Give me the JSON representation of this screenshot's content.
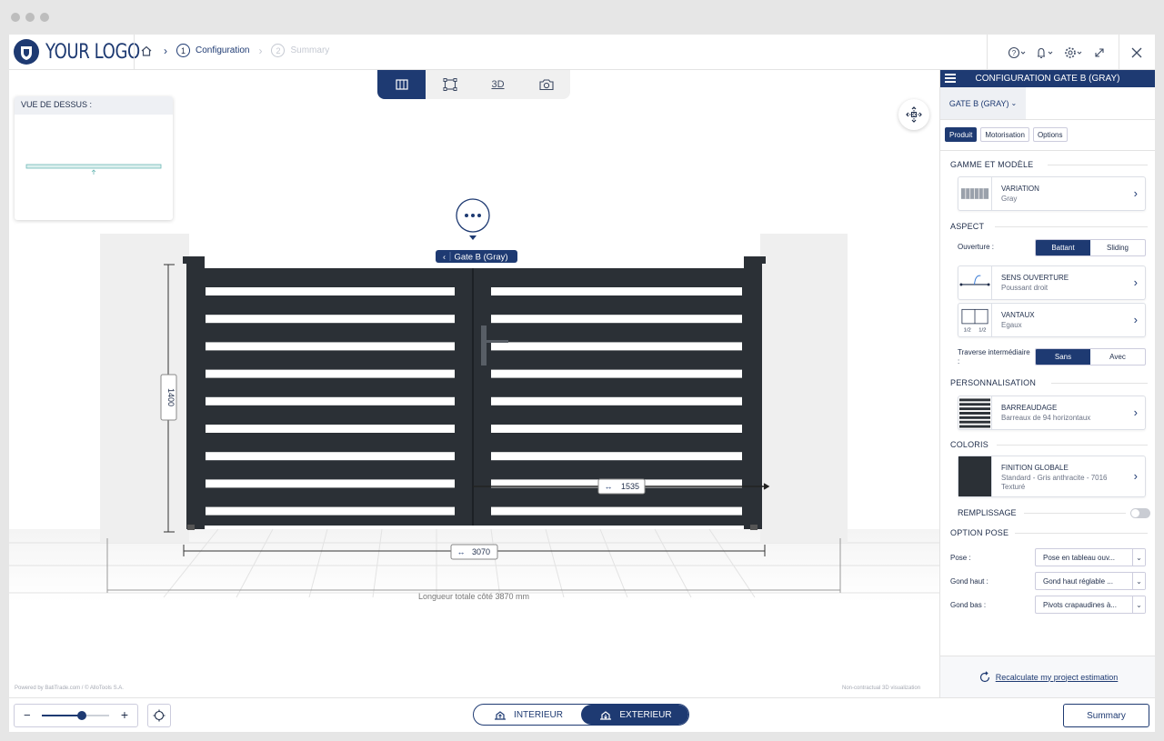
{
  "header": {
    "logo_text": "YOUR LOGO",
    "steps": [
      {
        "num": "1",
        "label": "Configuration",
        "active": true
      },
      {
        "num": "2",
        "label": "Summary",
        "active": false
      }
    ]
  },
  "viewer": {
    "view_tabs": [
      "plan-icon",
      "frame-icon",
      "3D",
      "camera-icon"
    ],
    "view_tab_3d_label": "3D",
    "top_view_title": "VUE DE DESSUS :",
    "gate_label": "Gate B (Gray)",
    "dim_height": "1400",
    "dim_leaf_width": "1535",
    "dim_gate_width": "3070",
    "total_length_label": "Longueur totale côté 3870 mm",
    "powered_by": "Powered by BatiTrade.com / © AlloTools S.A.",
    "non_contractual": "Non-contractual 3D visualization",
    "zoom_level": 0.6
  },
  "bottom": {
    "interior_label": "INTERIEUR",
    "exterior_label": "EXTERIEUR",
    "summary_label": "Summary"
  },
  "panel": {
    "title": "CONFIGURATION GATE B (GRAY)",
    "gate_select": "GATE B (GRAY)",
    "tabs": [
      "Produit",
      "Motorisation",
      "Options"
    ],
    "sections": {
      "gamme": "GAMME ET MODÈLE",
      "aspect": "ASPECT",
      "perso": "PERSONNALISATION",
      "coloris": "COLORIS",
      "option_pose": "OPTION POSE"
    },
    "variation": {
      "title": "VARIATION",
      "sub": "Gray"
    },
    "ouverture": {
      "label": "Ouverture :",
      "options": [
        "Battant",
        "Sliding"
      ],
      "selected": "Battant"
    },
    "sens": {
      "title": "SENS OUVERTURE",
      "sub": "Poussant droit"
    },
    "vantaux": {
      "title": "VANTAUX",
      "sub": "Egaux",
      "img_label_left": "1/2",
      "img_label_right": "1/2"
    },
    "traverse": {
      "label": "Traverse intermédiaire :",
      "options": [
        "Sans",
        "Avec"
      ],
      "selected": "Sans"
    },
    "barreaudage": {
      "title": "BARREAUDAGE",
      "sub": "Barreaux de 94 horizontaux"
    },
    "finition": {
      "title": "FINITION GLOBALE",
      "sub": "Standard - Gris anthracite - 7016 Texturé"
    },
    "remplissage": {
      "label": "REMPLISSAGE",
      "enabled": false
    },
    "pose": {
      "label": "Pose :",
      "value": "Pose en tableau ouv..."
    },
    "gond_haut": {
      "label": "Gond haut :",
      "value": "Gond haut réglable ..."
    },
    "gond_bas": {
      "label": "Gond bas :",
      "value": "Pivots crapaudines à..."
    },
    "recalc": "Recalculate my project estimation"
  },
  "colors": {
    "brand": "#1e3a72",
    "gate": "#2b3036"
  }
}
